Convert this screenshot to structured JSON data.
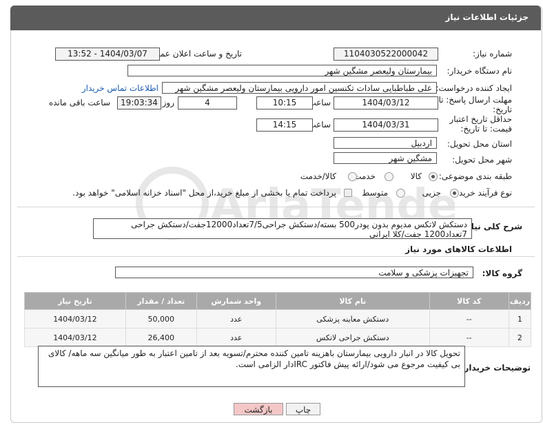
{
  "header": {
    "title": "جزئیات اطلاعات نیاز"
  },
  "fields": {
    "need_number_label": "شماره نیاز:",
    "need_number": "1104030522000042",
    "announce_label": "تاریخ و ساعت اعلان عمومی:",
    "announce_value": "1404/03/07 - 13:52",
    "buyer_org_label": "نام دستگاه خریدار:",
    "buyer_org": "بیمارستان ولیعصر مشگین شهر",
    "creator_label": "ایجاد کننده درخواست:",
    "creator": "علی طباطبایی سادات تکنسین امور دارویی بیمارستان ولیعصر مشگین شهر",
    "contact_link": "اطلاعات تماس خریدار",
    "deadline_label": "مهلت ارسال پاسخ: تا تاریخ:",
    "deadline_date": "1404/03/12",
    "time_label": "ساعت",
    "deadline_time": "10:15",
    "days_count": "4",
    "days_label": "روز و",
    "remaining_time": "19:03:34",
    "remaining_label": "ساعت باقی مانده",
    "min_validity_label": "حداقل تاریخ اعتبار قیمت: تا تاریخ:",
    "validity_date": "1404/03/31",
    "validity_time": "14:15",
    "province_label": "استان محل تحویل:",
    "province": "اردبیل",
    "city_label": "شهر محل تحویل:",
    "city": "مشگین شهر",
    "category_label": "طبقه بندی موضوعی:",
    "category_options": [
      "کالا",
      "خدمت",
      "کالا/خدمت"
    ],
    "process_label": "نوع فرآیند خرید :",
    "process_options": [
      "جزیی",
      "متوسط"
    ],
    "payment_note": "پرداخت تمام یا بخشی از مبلغ خرید،از محل \"اسناد خزانه اسلامی\" خواهد بود."
  },
  "description": {
    "label": "شرح کلی نیاز:",
    "text_line1": "دستکش لاتکس مدیوم بدون پودر500 بسته/دستکش جراحی7/5تعداد12000جفت/دستکش جراحی",
    "text_line2": "7تعداد1200 جفت/کلا ایرانی"
  },
  "goods": {
    "section_title": "اطلاعات کالاهای مورد نیاز",
    "group_label": "گروه کالا:",
    "group_value": "تجهیزات پزشکی و سلامت",
    "columns": [
      "ردیف",
      "کد کالا",
      "نام کالا",
      "واحد شمارش",
      "تعداد / مقدار",
      "تاریخ نیاز"
    ],
    "rows": [
      [
        "1",
        "--",
        "دستکش معاینه پزشکی",
        "عدد",
        "50,000",
        "1404/03/12"
      ],
      [
        "2",
        "--",
        "دستکش جراحی لاتکس",
        "عدد",
        "26,400",
        "1404/03/12"
      ]
    ]
  },
  "buyer_notes": {
    "label": "توضیحات خریدار:",
    "line1": "تحویل کالا در انبار دارویی بیمارستان باهزینه تامین کننده محترم/تسویه بعد از تامین اعتبار به طور میانگین سه ماهه/ کالای",
    "line2": "بی کیفیت مرجوع می شود/ارائه پیش فاکتور IRCدار الزامی است."
  },
  "buttons": {
    "print": "چاپ",
    "back": "بازگشت"
  },
  "colors": {
    "header_bg": "#5b5b5b",
    "table_header": "#a9a9a9",
    "back_btn": "#f4c7c7",
    "link": "#1a5bb5"
  }
}
